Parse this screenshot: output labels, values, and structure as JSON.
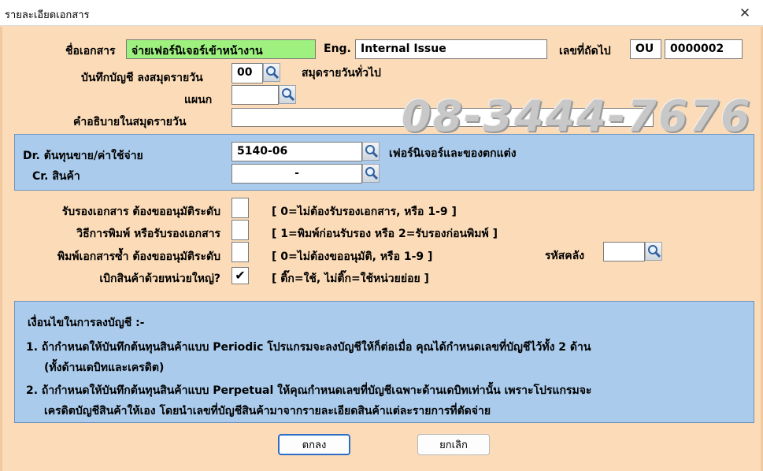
{
  "window": {
    "title": "รายละเอียดเอกสาร",
    "close_glyph": "✕"
  },
  "doc": {
    "name_label": "ชื่อเอกสาร",
    "name_value": "จ่ายเฟอร์นิเจอร์เข้าหน้างาน",
    "eng_label": "Eng.",
    "eng_value": "Internal Issue",
    "next_no_label": "เลขที่ถัดไป",
    "prefix_value": "OU",
    "next_no_value": "0000002"
  },
  "journal": {
    "label": "บันทึกบัญชี ลงสมุดรายวัน",
    "code_value": "00",
    "desc": "สมุดรายวันทั่วไป",
    "dept_label": "แผนก",
    "dept_value": "",
    "explain_label": "คำอธิบายในสมุดรายวัน",
    "explain_value": ""
  },
  "watermark": "08-3444-7676",
  "accounts": {
    "dr_label": "Dr. ต้นทุนขาย/ค่าใช้จ่าย",
    "dr_value": "5140-06",
    "dr_desc": "เฟอร์นิเจอร์และของตกแต่ง",
    "cr_label": "Cr. สินค้า",
    "cr_value": "-"
  },
  "options": {
    "approve_label": "รับรองเอกสาร ต้องขออนุมัติระดับ",
    "approve_hint": "[ 0=ไม่ต้องรับรองเอกสาร,  หรือ 1-9 ]",
    "print_label": "วิธีการพิมพ์ หรือรับรองเอกสาร",
    "print_hint": "[ 1=พิมพ์ก่อนรับรอง  หรือ 2=รับรองก่อนพิมพ์ ]",
    "reprint_label": "พิมพ์เอกสารซ้ำ ต้องขออนุมัติระดับ",
    "reprint_hint": "[ 0=ไม่ต้องขออนุมัติ,  หรือ 1-9 ]",
    "warehouse_label": "รหัสคลัง",
    "big_unit_label": "เบิกสินค้าด้วยหน่วยใหญ่?",
    "big_unit_checked": "✔",
    "big_unit_hint": "[ ติ๊ก=ใช้,  ไม่ติ๊ก=ใช้หน่วยย่อย ]"
  },
  "conditions": {
    "title": "เงื่อนไขในการลงบัญชี :-",
    "line1a": "1.  ถ้ากำหนดให้บันทึกต้นทุนสินค้าแบบ Periodic  โปรแกรมจะลงบัญชีให้ก็ต่อเมื่อ คุณได้กำหนดเลขที่บัญชีไว้ทั้ง 2 ด้าน",
    "line1b": "(ทั้งด้านเดบิทและเครดิต)",
    "line2a": "2.  ถ้ากำหนดให้บันทึกต้นทุนสินค้าแบบ Perpetual  ให้คุณกำหนดเลขที่บัญชีเฉพาะด้านเดบิทเท่านั้น  เพราะโปรแกรมจะ",
    "line2b": "เครดิตบัญชีสินค้าให้เอง  โดยนำเลขที่บัญชีสินค้ามาจากรายละเอียดสินค้าแต่ละรายการที่ตัดจ่าย"
  },
  "buttons": {
    "ok": "ตกลง",
    "cancel": "ยกเลิก"
  }
}
